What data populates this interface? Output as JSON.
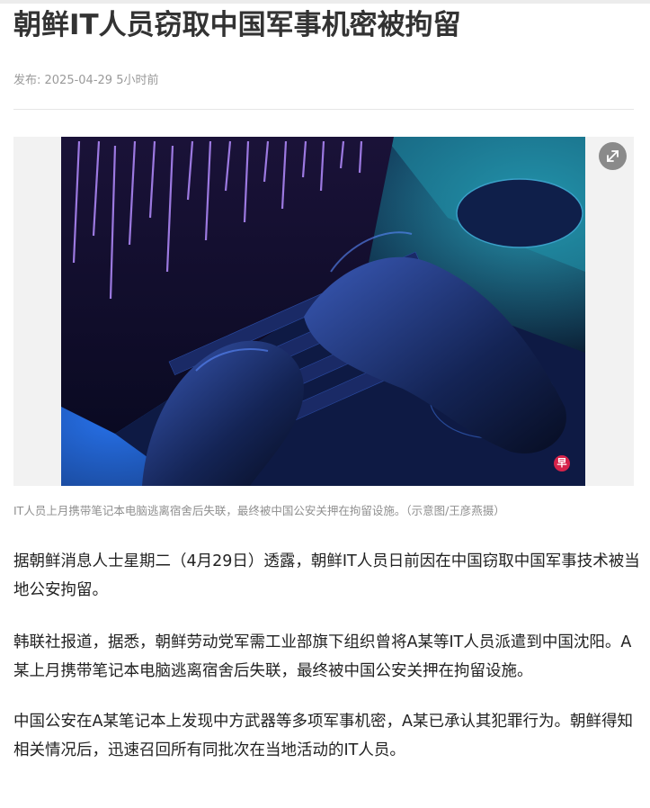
{
  "article": {
    "title": "朝鲜IT人员窃取中国军事机密被拘留",
    "meta": "发布: 2025-04-29 5小时前",
    "image_caption": "IT人员上月携带笔记本电脑逃离宿舍后失联，最终被中国公安关押在拘留设施。（示意图/王彦燕摄）",
    "watermark_char": "早",
    "paragraphs": [
      "据朝鲜消息人士星期二（4月29日）透露，朝鲜IT人员日前因在中国窃取中国军事技术被当地公安拘留。",
      "韩联社报道，据悉，朝鲜劳动党军需工业部旗下组织曾将A某等IT人员派遣到中国沈阳。A某上月携带笔记本电脑逃离宿舍后失联，最终被中国公安关押在拘留设施。",
      "中国公安在A某笔记本上发现中方武器等多项军事机密，A某已承认其犯罪行为。朝鲜得知相关情况后，迅速召回所有同批次在当地活动的IT人员。"
    ]
  },
  "icons": {
    "expand": "expand-icon",
    "watermark": "zaobao-logo-icon"
  },
  "colors": {
    "title": "#333333",
    "meta": "#9a9a9a",
    "body_text": "#222222",
    "caption": "#8f8f8f",
    "photo_tint": "#1a3fa8"
  }
}
